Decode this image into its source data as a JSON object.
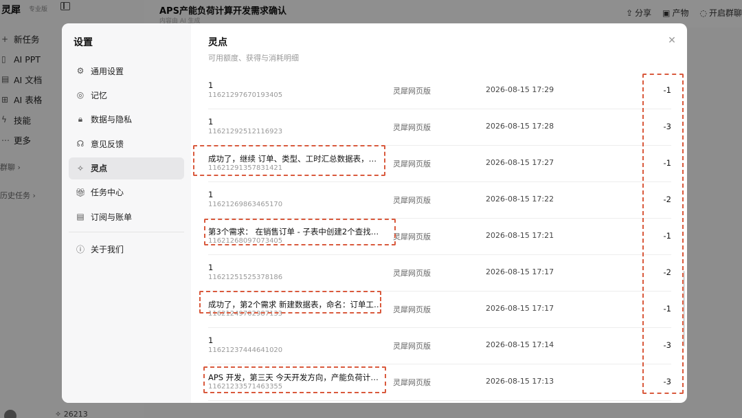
{
  "app": {
    "brand": "灵犀",
    "brand_badge": "专业版",
    "title": "APS产能负荷计算开发需求确认",
    "subtitle": "内容由 AI 生成",
    "nav": [
      {
        "icon": "plus-icon",
        "glyph": "+",
        "label": "新任务"
      },
      {
        "icon": "ppt-icon",
        "glyph": "▯",
        "label": "AI PPT"
      },
      {
        "icon": "doc-icon",
        "glyph": "▤",
        "label": "AI 文档"
      },
      {
        "icon": "sheet-icon",
        "glyph": "⊞",
        "label": "AI 表格"
      },
      {
        "icon": "skill-icon",
        "glyph": "ϟ",
        "label": "技能"
      },
      {
        "icon": "more-icon",
        "glyph": "⋯",
        "label": "更多"
      }
    ],
    "group_chat": "群聊",
    "history": "历史任务",
    "actions": [
      {
        "icon": "share-icon",
        "glyph": "⇪",
        "label": "分享"
      },
      {
        "icon": "product-icon",
        "glyph": "▣",
        "label": "产物"
      },
      {
        "icon": "chat-icon",
        "glyph": "◌",
        "label": "开启群聊"
      }
    ],
    "points_count": "26213"
  },
  "settings": {
    "title": "设置",
    "nav": [
      {
        "icon": "gear-icon",
        "glyph": "⚙",
        "label": "通用设置"
      },
      {
        "icon": "memory-icon",
        "glyph": "◎",
        "label": "记忆"
      },
      {
        "icon": "lock-icon",
        "glyph": "🔒︎",
        "label": "数据与隐私"
      },
      {
        "icon": "feedback-icon",
        "glyph": "☊",
        "label": "意见反馈"
      },
      {
        "icon": "sparkle-icon",
        "glyph": "✧",
        "label": "灵点",
        "active": true
      },
      {
        "icon": "gift-icon",
        "glyph": "🎁︎",
        "label": "任务中心"
      },
      {
        "icon": "bill-icon",
        "glyph": "▤",
        "label": "订阅与账单"
      }
    ],
    "about": {
      "icon": "info-icon",
      "glyph": "ⓘ",
      "label": "关于我们"
    }
  },
  "panel": {
    "title": "灵点",
    "subtitle": "可用额度、获得与消耗明细",
    "close_glyph": "✕"
  },
  "records": [
    {
      "desc": "1",
      "id": "11621297670193405",
      "source": "灵犀网页版",
      "time": "2026-08-15 17:29",
      "amount": "-1"
    },
    {
      "desc": "1",
      "id": "11621292512116923",
      "source": "灵犀网页版",
      "time": "2026-08-15 17:28",
      "amount": "-3"
    },
    {
      "desc": "成功了，继续 订单、类型、工时汇总数据表，继续...",
      "id": "11621291357831421",
      "source": "灵犀网页版",
      "time": "2026-08-15 17:27",
      "amount": "-1"
    },
    {
      "desc": "1",
      "id": "11621269863465170",
      "source": "灵犀网页版",
      "time": "2026-08-15 17:22",
      "amount": "-2"
    },
    {
      "desc": "第3个需求： 在销售订单 - 子表中创建2个查找引用...",
      "id": "11621268097073405",
      "source": "灵犀网页版",
      "time": "2026-08-15 17:21",
      "amount": "-1"
    },
    {
      "desc": "1",
      "id": "11621251525378186",
      "source": "灵犀网页版",
      "time": "2026-08-15 17:17",
      "amount": "-2"
    },
    {
      "desc": "成功了，第2个需求 新建数据表，命名：订单工时...",
      "id": "11621249702987133",
      "source": "灵犀网页版",
      "time": "2026-08-15 17:17",
      "amount": "-1"
    },
    {
      "desc": "1",
      "id": "11621237444641020",
      "source": "灵犀网页版",
      "time": "2026-08-15 17:14",
      "amount": "-3"
    },
    {
      "desc": "APS 开发，第三天 今天开发方向，产能负荷计算，...",
      "id": "11621233571463355",
      "source": "灵犀网页版",
      "time": "2026-08-15 17:13",
      "amount": "-3"
    }
  ]
}
